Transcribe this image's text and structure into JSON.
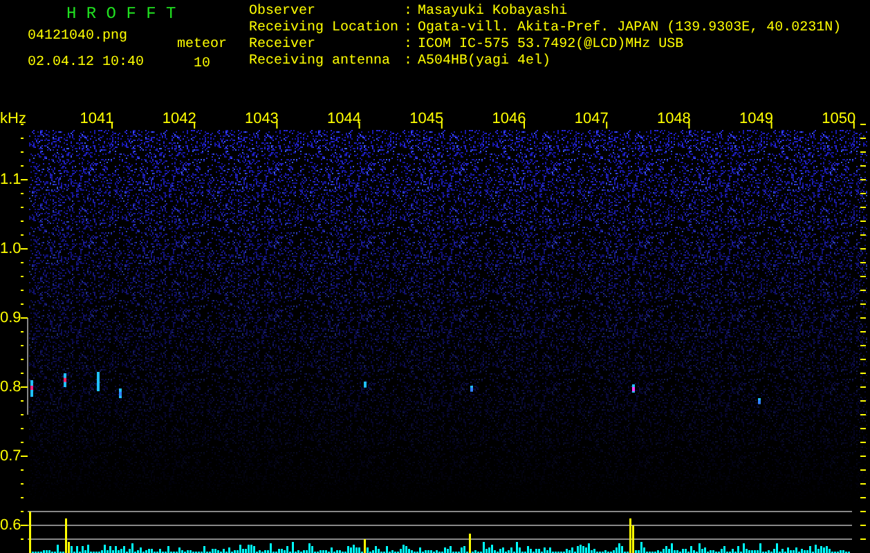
{
  "app": {
    "title": "H R O F F T"
  },
  "file": {
    "name": "04121040.png",
    "datetime": "02.04.12 10:40"
  },
  "meteor": {
    "label": "meteor",
    "count": "10"
  },
  "info": [
    {
      "label": "Observer",
      "colon": ":",
      "value": "Masayuki Kobayashi"
    },
    {
      "label": "Receiving Location",
      "colon": ":",
      "value": "Ogata-vill. Akita-Pref. JAPAN (139.9303E, 40.0231N)"
    },
    {
      "label": "Receiver",
      "colon": ":",
      "value": "ICOM IC-575 53.7492(@LCD)MHz USB"
    },
    {
      "label": "Receiving antenna",
      "colon": ":",
      "value": "A504HB(yagi 4el)"
    }
  ],
  "plot": {
    "y_unit": "kHz",
    "y_labels": [
      "1.1",
      "1.0",
      "0.9",
      "0.8",
      "0.7",
      "0.6"
    ],
    "x_labels": [
      "1041",
      "1042",
      "1043",
      "1044",
      "1045",
      "1046",
      "1047",
      "1048",
      "1049",
      "1050"
    ]
  }
}
